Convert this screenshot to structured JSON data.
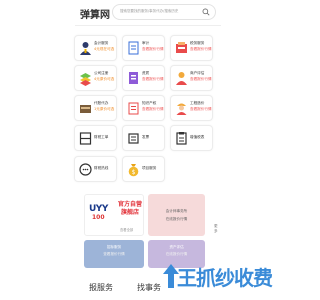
{
  "header": {
    "logo": "弹算网",
    "search_placeholder": "搜索您要找的服务/事务代办/搜索历史"
  },
  "cards": [
    {
      "title": "会计服务",
      "sub": "4元现在可选",
      "icon": "accountant-icon",
      "sub_color": "orange"
    },
    {
      "title": "审计",
      "sub": "查看报价行情",
      "icon": "audit-document-icon",
      "sub_color": "red"
    },
    {
      "title": "税务服务",
      "sub": "查看报价行情",
      "icon": "tax-service-icon",
      "sub_color": "red"
    },
    {
      "title": "公司注册",
      "sub": "4元原价可选",
      "icon": "company-register-icon",
      "sub_color": "orange"
    },
    {
      "title": "资质",
      "sub": "查看报价行情",
      "icon": "qualification-icon",
      "sub_color": "red"
    },
    {
      "title": "商户评估",
      "sub": "查看报价行情",
      "icon": "merchant-evaluation-icon",
      "sub_color": "red"
    },
    {
      "title": "代账代办",
      "sub": "1元原价可选",
      "icon": "bookkeeping-icon",
      "sub_color": "orange"
    },
    {
      "title": "知识产权",
      "sub": "查看报价行情",
      "icon": "ip-icon",
      "sub_color": "red"
    },
    {
      "title": "工程造价",
      "sub": "查看报价行情",
      "icon": "engineer-icon",
      "sub_color": "red"
    },
    {
      "title": "财税工单",
      "icon": "ledger-icon"
    },
    {
      "title": "发票",
      "icon": "invoice-icon"
    },
    {
      "title": "增值税表",
      "icon": "tax-form-icon"
    },
    {
      "title": "财税热线",
      "icon": "hotline-icon"
    },
    {
      "title": "项目服务",
      "icon": "money-bag-icon"
    }
  ],
  "banners": {
    "b1_number": "UYY",
    "b1_number2": "100",
    "b1_title": "官方自营旗舰店",
    "b1_sub": "查看全部",
    "b2_title": "会计师事务所",
    "b2_sub": "在线报价行情",
    "b3_title": "招标服务",
    "b3_sub": "查看报价行情",
    "b4_title": "资产评估",
    "b4_sub": "在线报价行情"
  },
  "side_tag": "更多",
  "tabs": [
    "报服务",
    "找事务"
  ],
  "watermark": "王抓纱收费",
  "colors": {
    "accent_red": "#e55555",
    "accent_orange": "#f08a24",
    "watermark_blue": "#3a8bd8"
  }
}
